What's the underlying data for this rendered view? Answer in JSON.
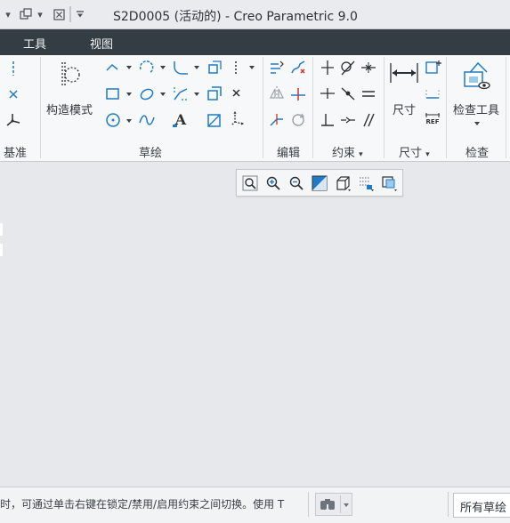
{
  "window": {
    "title": "S2D0005 (活动的) - Creo Parametric 9.0"
  },
  "menu": {
    "items": [
      "工具",
      "视图"
    ]
  },
  "ribbon": {
    "groups": {
      "datum": "基准",
      "sketch": "草绘",
      "edit": "编辑",
      "constrain": "约束",
      "dimension": "尺寸",
      "inspect": "检查"
    },
    "big_buttons": {
      "construction_mode": "构造模式",
      "dimension": "尺寸",
      "inspect_tools": "检查工具"
    },
    "text_tool_glyph": "A",
    "ref_glyph": "REF"
  },
  "status": {
    "message": "时，可通过单击右键在锁定/禁用/启用约束之间切换。使用 T",
    "filter": "所有草绘"
  },
  "colors": {
    "accent_blue": "#1f7bc6",
    "menu_bg": "#343d43",
    "canvas_bg": "#e6e8eb"
  }
}
